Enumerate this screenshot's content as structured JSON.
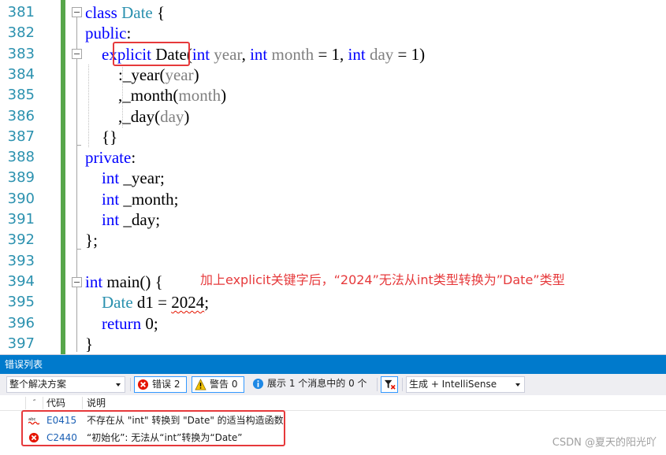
{
  "editor": {
    "line_numbers": [
      "381",
      "382",
      "383",
      "384",
      "385",
      "386",
      "387",
      "388",
      "389",
      "390",
      "391",
      "392",
      "393",
      "394",
      "395",
      "396",
      "397"
    ],
    "lines": [
      {
        "tokens": [
          {
            "t": "class",
            "c": "kw"
          },
          {
            "t": " "
          },
          {
            "t": "Date",
            "c": "ty"
          },
          {
            "t": " {"
          }
        ]
      },
      {
        "tokens": [
          {
            "t": "public",
            "c": "kw"
          },
          {
            "t": ":"
          }
        ]
      },
      {
        "tokens": [
          {
            "t": "    "
          },
          {
            "t": "explicit",
            "c": "kw"
          },
          {
            "t": " Date("
          },
          {
            "t": "int",
            "c": "kw"
          },
          {
            "t": " "
          },
          {
            "t": "year",
            "c": "pm"
          },
          {
            "t": ", "
          },
          {
            "t": "int",
            "c": "kw"
          },
          {
            "t": " "
          },
          {
            "t": "month",
            "c": "pm"
          },
          {
            "t": " = 1, "
          },
          {
            "t": "int",
            "c": "kw"
          },
          {
            "t": " "
          },
          {
            "t": "day",
            "c": "pm"
          },
          {
            "t": " = 1)"
          }
        ]
      },
      {
        "tokens": [
          {
            "t": "        :_year("
          },
          {
            "t": "year",
            "c": "pm"
          },
          {
            "t": ")"
          }
        ]
      },
      {
        "tokens": [
          {
            "t": "        ,_month("
          },
          {
            "t": "month",
            "c": "pm"
          },
          {
            "t": ")"
          }
        ]
      },
      {
        "tokens": [
          {
            "t": "        ,_day("
          },
          {
            "t": "day",
            "c": "pm"
          },
          {
            "t": ")"
          }
        ]
      },
      {
        "tokens": [
          {
            "t": "    {}"
          }
        ]
      },
      {
        "tokens": [
          {
            "t": "private",
            "c": "kw"
          },
          {
            "t": ":"
          }
        ]
      },
      {
        "tokens": [
          {
            "t": "    "
          },
          {
            "t": "int",
            "c": "kw"
          },
          {
            "t": " _year;"
          }
        ]
      },
      {
        "tokens": [
          {
            "t": "    "
          },
          {
            "t": "int",
            "c": "kw"
          },
          {
            "t": " _month;"
          }
        ]
      },
      {
        "tokens": [
          {
            "t": "    "
          },
          {
            "t": "int",
            "c": "kw"
          },
          {
            "t": " _day;"
          }
        ]
      },
      {
        "tokens": [
          {
            "t": "};"
          }
        ]
      },
      {
        "tokens": []
      },
      {
        "tokens": [
          {
            "t": "int",
            "c": "kw"
          },
          {
            "t": " main() {"
          }
        ]
      },
      {
        "tokens": [
          {
            "t": "    "
          },
          {
            "t": "Date",
            "c": "ty"
          },
          {
            "t": " d1 = "
          },
          {
            "t": "2024",
            "c": "squiggle"
          },
          {
            "t": ";"
          }
        ]
      },
      {
        "tokens": [
          {
            "t": "    "
          },
          {
            "t": "return",
            "c": "kw"
          },
          {
            "t": " 0;"
          }
        ]
      },
      {
        "tokens": [
          {
            "t": "}"
          }
        ]
      }
    ],
    "annotation": "加上explicit关键字后，“2024”无法从int类型转换为”Date”类型"
  },
  "error_panel": {
    "title": "错误列表",
    "scope_dropdown": "整个解决方案",
    "errors_button": "错误 2",
    "warnings_button": "警告 0",
    "messages_button": "展示 1 个消息中的 0 个",
    "source_dropdown": "生成 + IntelliSense",
    "col_code": "代码",
    "col_desc": "说明",
    "rows": [
      {
        "icon": "intellisense-error-icon",
        "code": "E0415",
        "desc": "不存在从 \"int\" 转换到 \"Date\" 的适当构造函数"
      },
      {
        "icon": "error-icon",
        "code": "C2440",
        "desc": "“初始化”: 无法从“int”转换为“Date”"
      }
    ],
    "colors": {
      "accent": "#007acc",
      "error": "#e51400",
      "warning": "#f5c400",
      "info": "#1e88e5"
    }
  },
  "watermark": "CSDN @夏天的阳光吖"
}
